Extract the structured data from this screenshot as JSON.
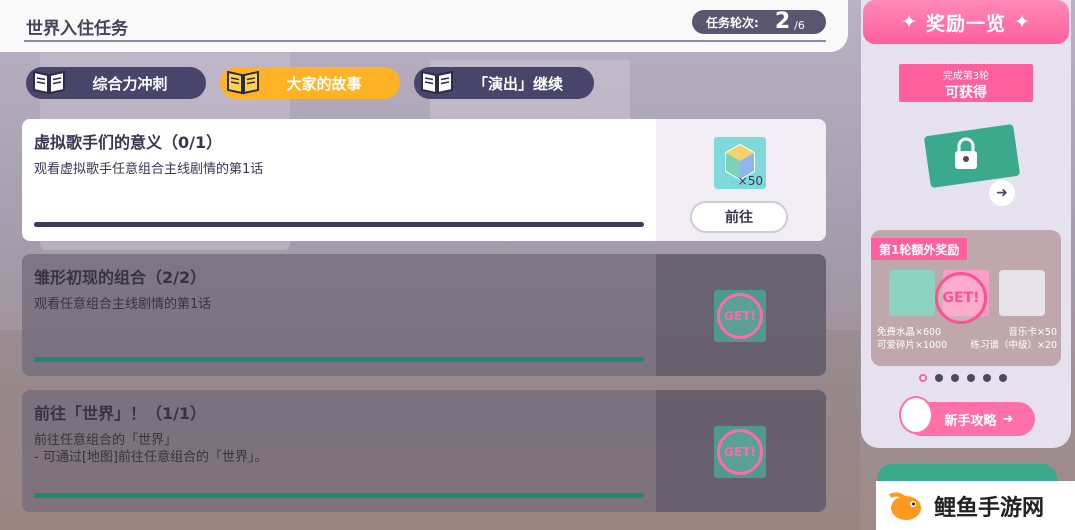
{
  "header": {
    "title": "世界入住任务",
    "round_label": "任务轮次:",
    "round_current": "2",
    "round_total": "/6"
  },
  "tabs": [
    {
      "label": "综合力冲刺",
      "icon": "book-icon",
      "active": false
    },
    {
      "label": "大家的故事",
      "icon": "book-icon",
      "active": true
    },
    {
      "label": "「演出」继续",
      "icon": "book-icon",
      "active": false
    }
  ],
  "missions": [
    {
      "title": "虚拟歌手们的意义（0/1）",
      "description": "观看虚拟歌手任意组合主线剧情的第1话",
      "reward_qty": "×50",
      "reward_icon": "crystal-icon",
      "action_label": "前往",
      "progress": 0,
      "completed": false
    },
    {
      "title": "雏形初现的组合（2/2）",
      "description": "观看任意组合主线剧情的第1话",
      "stamp": "GET!",
      "progress": 1,
      "completed": true
    },
    {
      "title": "前往「世界」！（1/1）",
      "description_lines": [
        "前往任意组合的「世界」",
        "- 可通过[地图]前往任意组合的「世界」。"
      ],
      "stamp": "GET!",
      "progress": 1,
      "completed": true
    }
  ],
  "reward_panel": {
    "title": "奖励一览",
    "ribbon_line1": "完成第3轮",
    "ribbon_line2": "可获得",
    "bonus_tag": "第1轮额外奖励",
    "bonus_stamp": "GET!",
    "bonus_items": [
      [
        "免费水晶×600",
        "音乐卡×50"
      ],
      [
        "可爱碎片×1000",
        "练习谱（中级）×20"
      ]
    ],
    "page_dots": 6,
    "active_dot": 0,
    "guide_label": "新手攻略"
  },
  "watermark": {
    "text": "鲤鱼手游网"
  },
  "colors": {
    "active_tab": "#ffb224",
    "inactive_tab": "#49456a",
    "accent_pink": "#ff5f9c",
    "progress_done": "#1f8a72"
  }
}
